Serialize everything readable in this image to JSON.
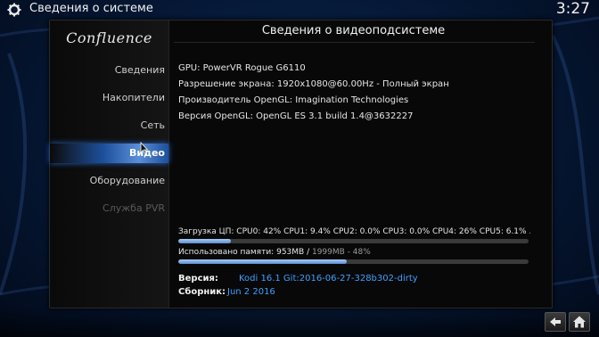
{
  "header": {
    "title": "Сведения о системе",
    "clock": "3:27"
  },
  "logo": {
    "text": "Confluence"
  },
  "sidebar": {
    "items": [
      {
        "label": "Сведения",
        "state": "normal"
      },
      {
        "label": "Накопители",
        "state": "normal"
      },
      {
        "label": "Сеть",
        "state": "normal"
      },
      {
        "label": "Видео",
        "state": "active"
      },
      {
        "label": "Оборудование",
        "state": "normal"
      },
      {
        "label": "Служба PVR",
        "state": "disabled"
      }
    ]
  },
  "content": {
    "title": "Сведения о видеоподсистеме",
    "lines": [
      "GPU: PowerVR Rogue G6110",
      "Разрешение экрана: 1920x1080@60.00Hz - Полный экран",
      "Производитель OpenGL: Imagination Technologies",
      "Версия OpenGL: OpenGL ES 3.1 build 1.4@3632227"
    ],
    "cpu": {
      "text": "Загрузка ЦП: CPU0:  42% CPU1: 9.4% CPU2: 0.0% CPU3: 0.0% CPU4:  26% CPU5: 6.1% ...",
      "fill_percent": 15
    },
    "memory": {
      "label": "Использовано памяти: ",
      "used": "953MB",
      "sep": " / ",
      "total": "1999MB - 48%",
      "fill_percent": 48
    },
    "version": {
      "label": "Версия:",
      "value": "Kodi 16.1 Git:2016-06-27-328b302-dirty"
    },
    "build": {
      "label": "Сборник:",
      "value": "Jun  2 2016"
    }
  },
  "bottom": {
    "buttons": [
      "back-icon",
      "home-icon"
    ]
  },
  "colors": {
    "accent": "#3ea0ff",
    "active_item": "#5a8fd8",
    "panel_bg": "#080808"
  }
}
